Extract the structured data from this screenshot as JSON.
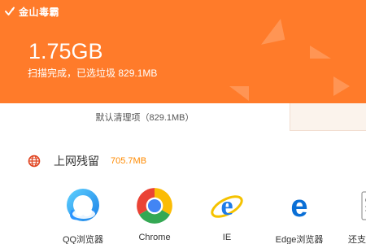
{
  "app": {
    "brand": "金山毒霸"
  },
  "header": {
    "size_value": "1.75GB",
    "scan_status_prefix": "扫描完成，已选垃圾",
    "scan_status_size": "829.1MB",
    "accent_color": "#ff7b2a"
  },
  "tabs": {
    "default_label": "默认清理项（829.1MB）"
  },
  "section": {
    "title": "上网残留",
    "size": "705.7MB",
    "icon": "globe-icon",
    "size_color": "#ff8a00"
  },
  "browsers": [
    {
      "label": "QQ浏览器",
      "icon": "qq-browser-icon"
    },
    {
      "label": "Chrome",
      "icon": "chrome-icon"
    },
    {
      "label": "IE",
      "icon": "ie-icon"
    },
    {
      "label": "Edge浏览器",
      "icon": "edge-icon"
    },
    {
      "label": "还支",
      "icon": "restore-icon"
    }
  ]
}
